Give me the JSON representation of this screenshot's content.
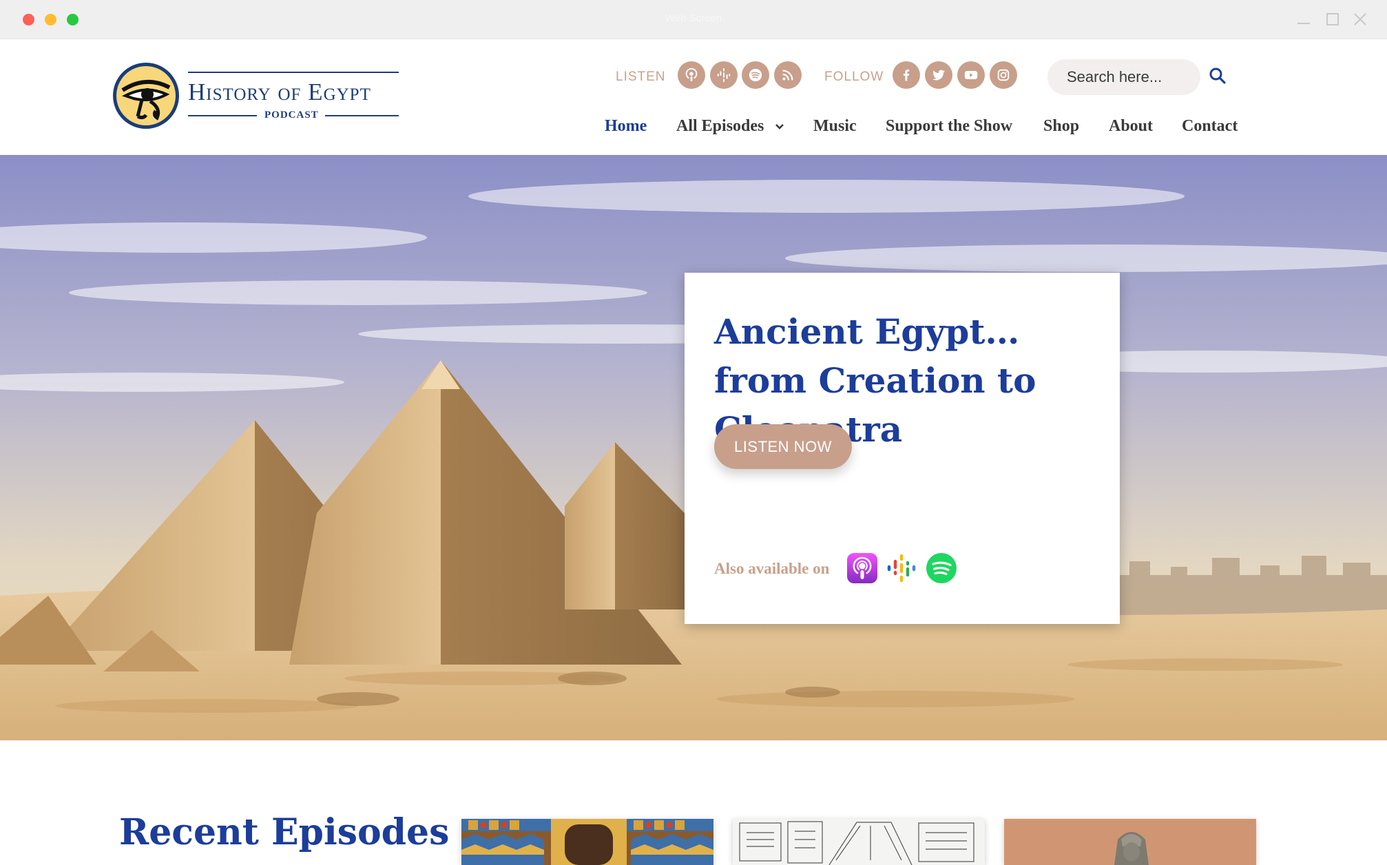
{
  "window": {
    "title": "Web Screen"
  },
  "brand": {
    "logo_title": "History of Egypt",
    "logo_subtitle": "PODCAST",
    "primary_color": "#1c3d9a",
    "accent_color": "#c89f8b"
  },
  "topbar": {
    "listen_label": "LISTEN",
    "follow_label": "FOLLOW",
    "listen_icons": [
      "apple-podcasts-icon",
      "google-podcasts-icon",
      "spotify-icon",
      "rss-icon"
    ],
    "follow_icons": [
      "facebook-icon",
      "twitter-icon",
      "youtube-icon",
      "instagram-icon"
    ],
    "search_placeholder": "Search here..."
  },
  "nav": {
    "items": [
      {
        "label": "Home",
        "active": true
      },
      {
        "label": "All Episodes",
        "has_dropdown": true
      },
      {
        "label": "Music"
      },
      {
        "label": "Support the Show"
      },
      {
        "label": "Shop"
      },
      {
        "label": "About"
      },
      {
        "label": "Contact"
      }
    ]
  },
  "hero": {
    "title": "Ancient Egypt… from Creation to Cleopatra",
    "cta_label": "LISTEN NOW",
    "available_label": "Also available on",
    "platform_icons": [
      "apple-podcasts-icon",
      "google-podcasts-icon",
      "spotify-icon"
    ]
  },
  "recent": {
    "title": "Recent Episodes"
  }
}
